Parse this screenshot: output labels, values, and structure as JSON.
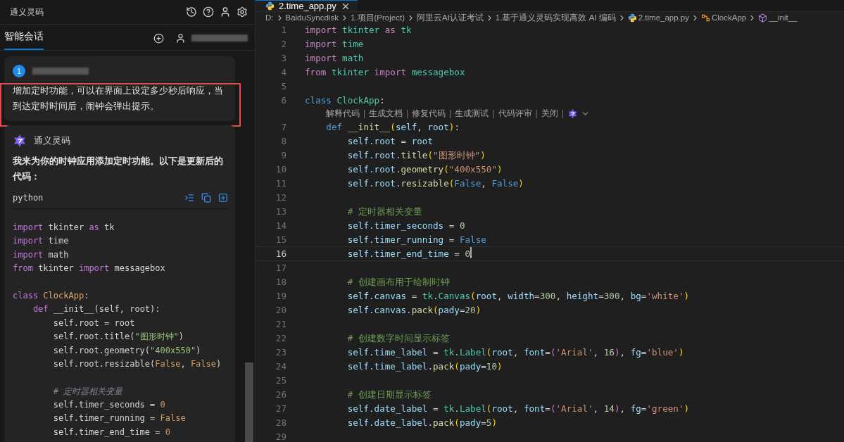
{
  "sidebar": {
    "title": "通义灵码",
    "tab": {
      "label": "智能会话",
      "selected": true
    },
    "user_message": {
      "index": "1",
      "text": "增加定时功能，可以在界面上设定多少秒后响应，当到达定时时间后，闹钟会弹出提示。",
      "highlighted": true
    },
    "reply": {
      "author": "通义灵码",
      "text": "我来为你的时钟应用添加定时功能。以下是更新后的代码：",
      "code_block": {
        "language": "python",
        "lines": [
          {
            "kind": "code",
            "tokens": [
              {
                "text": "import",
                "kind": "kw"
              },
              {
                "text": " tkinter ",
                "kind": "plain"
              },
              {
                "text": "as",
                "kind": "kw"
              },
              {
                "text": " tk",
                "kind": "plain"
              }
            ]
          },
          {
            "kind": "code",
            "tokens": [
              {
                "text": "import",
                "kind": "kw"
              },
              {
                "text": " time",
                "kind": "plain"
              }
            ]
          },
          {
            "kind": "code",
            "tokens": [
              {
                "text": "import",
                "kind": "kw"
              },
              {
                "text": " math",
                "kind": "plain"
              }
            ]
          },
          {
            "kind": "code",
            "tokens": [
              {
                "text": "from",
                "kind": "kw"
              },
              {
                "text": " tkinter ",
                "kind": "plain"
              },
              {
                "text": "import",
                "kind": "kw"
              },
              {
                "text": " messagebox",
                "kind": "plain"
              }
            ]
          },
          {
            "kind": "blank"
          },
          {
            "kind": "code",
            "tokens": [
              {
                "text": "class",
                "kind": "kw"
              },
              {
                "text": " ClockApp",
                "kind": "cls"
              },
              {
                "text": ":",
                "kind": "plain"
              }
            ]
          },
          {
            "kind": "code",
            "tokens": [
              {
                "text": "    def",
                "kind": "def"
              },
              {
                "text": " __init__",
                "kind": "fn"
              },
              {
                "text": "(self, root):",
                "kind": "plain"
              }
            ]
          },
          {
            "kind": "code",
            "tokens": [
              {
                "text": "        self.root = root",
                "kind": "plain"
              }
            ]
          },
          {
            "kind": "code",
            "tokens": [
              {
                "text": "        self.root.title(",
                "kind": "plain"
              },
              {
                "text": "\"图形时钟\"",
                "kind": "str"
              },
              {
                "text": ")",
                "kind": "plain"
              }
            ]
          },
          {
            "kind": "code",
            "tokens": [
              {
                "text": "        self.root.geometry(",
                "kind": "plain"
              },
              {
                "text": "\"400x550\"",
                "kind": "str"
              },
              {
                "text": ")",
                "kind": "plain"
              }
            ]
          },
          {
            "kind": "code",
            "tokens": [
              {
                "text": "        self.root.resizable(",
                "kind": "plain"
              },
              {
                "text": "False",
                "kind": "const"
              },
              {
                "text": ", ",
                "kind": "plain"
              },
              {
                "text": "False",
                "kind": "const"
              },
              {
                "text": ")",
                "kind": "plain"
              }
            ]
          },
          {
            "kind": "blank"
          },
          {
            "kind": "code",
            "tokens": [
              {
                "text": "        # 定时器相关变量",
                "kind": "com"
              }
            ]
          },
          {
            "kind": "code",
            "tokens": [
              {
                "text": "        self.timer_seconds = ",
                "kind": "plain"
              },
              {
                "text": "0",
                "kind": "num"
              }
            ]
          },
          {
            "kind": "code",
            "tokens": [
              {
                "text": "        self.timer_running = ",
                "kind": "plain"
              },
              {
                "text": "False",
                "kind": "const"
              }
            ]
          },
          {
            "kind": "code",
            "tokens": [
              {
                "text": "        self.timer_end_time = ",
                "kind": "plain"
              },
              {
                "text": "0",
                "kind": "num"
              }
            ]
          }
        ]
      }
    }
  },
  "editor": {
    "tab": {
      "label": "2.time_app.py",
      "selected": true
    },
    "breadcrumbs": [
      {
        "label": "D:",
        "kind": "text"
      },
      {
        "label": "BaiduSyncdisk",
        "kind": "text"
      },
      {
        "label": "1.项目(Project)",
        "kind": "text"
      },
      {
        "label": "阿里云AI认证考试",
        "kind": "text"
      },
      {
        "label": "1.基于通义灵码实现高效 AI 编码",
        "kind": "text"
      },
      {
        "label": "2.time_app.py",
        "kind": "file"
      },
      {
        "label": "ClockApp",
        "kind": "class"
      },
      {
        "label": "__init__",
        "kind": "method"
      }
    ],
    "lines": [
      {
        "kind": "code",
        "number": "1",
        "current": false,
        "tokens": [
          {
            "text": "import",
            "kind": "kw"
          },
          {
            "text": " tkinter ",
            "kind": "mod"
          },
          {
            "text": "as",
            "kind": "kw"
          },
          {
            "text": " tk",
            "kind": "mod"
          }
        ]
      },
      {
        "kind": "code",
        "number": "2",
        "current": false,
        "tokens": [
          {
            "text": "import",
            "kind": "kw"
          },
          {
            "text": " time",
            "kind": "mod"
          }
        ]
      },
      {
        "kind": "code",
        "number": "3",
        "current": false,
        "tokens": [
          {
            "text": "import",
            "kind": "kw"
          },
          {
            "text": " math",
            "kind": "mod"
          }
        ]
      },
      {
        "kind": "code",
        "number": "4",
        "current": false,
        "tokens": [
          {
            "text": "from",
            "kind": "kw"
          },
          {
            "text": " tkinter ",
            "kind": "mod"
          },
          {
            "text": "import",
            "kind": "kw"
          },
          {
            "text": " messagebox",
            "kind": "mod"
          }
        ]
      },
      {
        "kind": "code",
        "number": "5",
        "current": false
      },
      {
        "kind": "code",
        "number": "6",
        "current": false,
        "tokens": [
          {
            "text": "class",
            "kind": "def"
          },
          {
            "text": " ClockApp",
            "kind": "cls"
          },
          {
            "text": ":",
            "kind": "punc"
          }
        ]
      },
      {
        "kind": "codelens",
        "items": [
          {
            "label": "解释代码",
            "kind": "action"
          },
          {
            "label": "|",
            "kind": "separator"
          },
          {
            "label": "生成文档",
            "kind": "action"
          },
          {
            "label": "|",
            "kind": "separator"
          },
          {
            "label": "修复代码",
            "kind": "action"
          },
          {
            "label": "|",
            "kind": "separator"
          },
          {
            "label": "生成测试",
            "kind": "action"
          },
          {
            "label": "|",
            "kind": "separator"
          },
          {
            "label": "代码评审",
            "kind": "action"
          },
          {
            "label": "|",
            "kind": "separator"
          },
          {
            "label": "关闭",
            "kind": "action"
          },
          {
            "label": "|",
            "kind": "separator"
          }
        ]
      },
      {
        "kind": "code",
        "number": "7",
        "current": false,
        "tokens": [
          {
            "text": "    def",
            "kind": "def"
          },
          {
            "text": " __init__",
            "kind": "fn"
          },
          {
            "text": "(",
            "kind": "paren"
          },
          {
            "text": "self",
            "kind": "var"
          },
          {
            "text": ", ",
            "kind": "punc"
          },
          {
            "text": "root",
            "kind": "var"
          },
          {
            "text": ")",
            "kind": "paren"
          },
          {
            "text": ":",
            "kind": "punc"
          }
        ]
      },
      {
        "kind": "code",
        "number": "8",
        "current": false,
        "tokens": [
          {
            "text": "        self.root",
            "kind": "var"
          },
          {
            "text": " = ",
            "kind": "punc"
          },
          {
            "text": "root",
            "kind": "var"
          }
        ]
      },
      {
        "kind": "code",
        "number": "9",
        "current": false,
        "tokens": [
          {
            "text": "        self.root.",
            "kind": "var"
          },
          {
            "text": "title",
            "kind": "fn"
          },
          {
            "text": "(",
            "kind": "paren"
          },
          {
            "text": "\"图形时钟\"",
            "kind": "str"
          },
          {
            "text": ")",
            "kind": "paren"
          }
        ]
      },
      {
        "kind": "code",
        "number": "10",
        "current": false,
        "tokens": [
          {
            "text": "        self.root.",
            "kind": "var"
          },
          {
            "text": "geometry",
            "kind": "fn"
          },
          {
            "text": "(",
            "kind": "paren"
          },
          {
            "text": "\"400x550\"",
            "kind": "str"
          },
          {
            "text": ")",
            "kind": "paren"
          }
        ]
      },
      {
        "kind": "code",
        "number": "11",
        "current": false,
        "tokens": [
          {
            "text": "        self.root.",
            "kind": "var"
          },
          {
            "text": "resizable",
            "kind": "fn"
          },
          {
            "text": "(",
            "kind": "paren"
          },
          {
            "text": "False",
            "kind": "const"
          },
          {
            "text": ", ",
            "kind": "punc"
          },
          {
            "text": "False",
            "kind": "const"
          },
          {
            "text": ")",
            "kind": "paren"
          }
        ]
      },
      {
        "kind": "code",
        "number": "12",
        "current": false
      },
      {
        "kind": "code",
        "number": "13",
        "current": false,
        "tokens": [
          {
            "text": "        # 定时器相关变量",
            "kind": "com"
          }
        ]
      },
      {
        "kind": "code",
        "number": "14",
        "current": false,
        "tokens": [
          {
            "text": "        self.timer_seconds",
            "kind": "var"
          },
          {
            "text": " = ",
            "kind": "punc"
          },
          {
            "text": "0",
            "kind": "num"
          }
        ]
      },
      {
        "kind": "code",
        "number": "15",
        "current": false,
        "tokens": [
          {
            "text": "        self.timer_running",
            "kind": "var"
          },
          {
            "text": " = ",
            "kind": "punc"
          },
          {
            "text": "False",
            "kind": "const"
          }
        ]
      },
      {
        "kind": "code",
        "number": "16",
        "current": true,
        "tokens": [
          {
            "text": "        self.timer_end_time",
            "kind": "var"
          },
          {
            "text": " = ",
            "kind": "punc"
          },
          {
            "text": "0",
            "kind": "num"
          }
        ]
      },
      {
        "kind": "code",
        "number": "17",
        "current": false
      },
      {
        "kind": "code",
        "number": "18",
        "current": false,
        "tokens": [
          {
            "text": "        # 创建画布用于绘制时钟",
            "kind": "com"
          }
        ]
      },
      {
        "kind": "code",
        "number": "19",
        "current": false,
        "tokens": [
          {
            "text": "        self.canvas",
            "kind": "var"
          },
          {
            "text": " = ",
            "kind": "punc"
          },
          {
            "text": "tk",
            "kind": "mod"
          },
          {
            "text": ".",
            "kind": "punc"
          },
          {
            "text": "Canvas",
            "kind": "cls"
          },
          {
            "text": "(",
            "kind": "paren"
          },
          {
            "text": "root",
            "kind": "var"
          },
          {
            "text": ", ",
            "kind": "punc"
          },
          {
            "text": "width",
            "kind": "var"
          },
          {
            "text": "=",
            "kind": "punc"
          },
          {
            "text": "300",
            "kind": "num"
          },
          {
            "text": ", ",
            "kind": "punc"
          },
          {
            "text": "height",
            "kind": "var"
          },
          {
            "text": "=",
            "kind": "punc"
          },
          {
            "text": "300",
            "kind": "num"
          },
          {
            "text": ", ",
            "kind": "punc"
          },
          {
            "text": "bg",
            "kind": "var"
          },
          {
            "text": "=",
            "kind": "punc"
          },
          {
            "text": "'white'",
            "kind": "str"
          },
          {
            "text": ")",
            "kind": "paren"
          }
        ]
      },
      {
        "kind": "code",
        "number": "20",
        "current": false,
        "tokens": [
          {
            "text": "        self.canvas.",
            "kind": "var"
          },
          {
            "text": "pack",
            "kind": "fn"
          },
          {
            "text": "(",
            "kind": "paren"
          },
          {
            "text": "pady",
            "kind": "var"
          },
          {
            "text": "=",
            "kind": "punc"
          },
          {
            "text": "20",
            "kind": "num"
          },
          {
            "text": ")",
            "kind": "paren"
          }
        ]
      },
      {
        "kind": "code",
        "number": "21",
        "current": false
      },
      {
        "kind": "code",
        "number": "22",
        "current": false,
        "tokens": [
          {
            "text": "        # 创建数字时间显示标签",
            "kind": "com"
          }
        ]
      },
      {
        "kind": "code",
        "number": "23",
        "current": false,
        "tokens": [
          {
            "text": "        self.time_label",
            "kind": "var"
          },
          {
            "text": " = ",
            "kind": "punc"
          },
          {
            "text": "tk",
            "kind": "mod"
          },
          {
            "text": ".",
            "kind": "punc"
          },
          {
            "text": "Label",
            "kind": "cls"
          },
          {
            "text": "(",
            "kind": "paren"
          },
          {
            "text": "root",
            "kind": "var"
          },
          {
            "text": ", ",
            "kind": "punc"
          },
          {
            "text": "font",
            "kind": "var"
          },
          {
            "text": "=",
            "kind": "punc"
          },
          {
            "text": "(",
            "kind": "paren2"
          },
          {
            "text": "'Arial'",
            "kind": "str"
          },
          {
            "text": ", ",
            "kind": "punc"
          },
          {
            "text": "16",
            "kind": "num"
          },
          {
            "text": ")",
            "kind": "paren2"
          },
          {
            "text": ", ",
            "kind": "punc"
          },
          {
            "text": "fg",
            "kind": "var"
          },
          {
            "text": "=",
            "kind": "punc"
          },
          {
            "text": "'blue'",
            "kind": "str"
          },
          {
            "text": ")",
            "kind": "paren"
          }
        ]
      },
      {
        "kind": "code",
        "number": "24",
        "current": false,
        "tokens": [
          {
            "text": "        self.time_label.",
            "kind": "var"
          },
          {
            "text": "pack",
            "kind": "fn"
          },
          {
            "text": "(",
            "kind": "paren"
          },
          {
            "text": "pady",
            "kind": "var"
          },
          {
            "text": "=",
            "kind": "punc"
          },
          {
            "text": "10",
            "kind": "num"
          },
          {
            "text": ")",
            "kind": "paren"
          }
        ]
      },
      {
        "kind": "code",
        "number": "25",
        "current": false
      },
      {
        "kind": "code",
        "number": "26",
        "current": false,
        "tokens": [
          {
            "text": "        # 创建日期显示标签",
            "kind": "com"
          }
        ]
      },
      {
        "kind": "code",
        "number": "27",
        "current": false,
        "tokens": [
          {
            "text": "        self.date_label",
            "kind": "var"
          },
          {
            "text": " = ",
            "kind": "punc"
          },
          {
            "text": "tk",
            "kind": "mod"
          },
          {
            "text": ".",
            "kind": "punc"
          },
          {
            "text": "Label",
            "kind": "cls"
          },
          {
            "text": "(",
            "kind": "paren"
          },
          {
            "text": "root",
            "kind": "var"
          },
          {
            "text": ", ",
            "kind": "punc"
          },
          {
            "text": "font",
            "kind": "var"
          },
          {
            "text": "=",
            "kind": "punc"
          },
          {
            "text": "(",
            "kind": "paren2"
          },
          {
            "text": "'Arial'",
            "kind": "str"
          },
          {
            "text": ", ",
            "kind": "punc"
          },
          {
            "text": "14",
            "kind": "num"
          },
          {
            "text": ")",
            "kind": "paren2"
          },
          {
            "text": ", ",
            "kind": "punc"
          },
          {
            "text": "fg",
            "kind": "var"
          },
          {
            "text": "=",
            "kind": "punc"
          },
          {
            "text": "'green'",
            "kind": "str"
          },
          {
            "text": ")",
            "kind": "paren"
          }
        ]
      },
      {
        "kind": "code",
        "number": "28",
        "current": false,
        "tokens": [
          {
            "text": "        self.date_label.",
            "kind": "var"
          },
          {
            "text": "pack",
            "kind": "fn"
          },
          {
            "text": "(",
            "kind": "paren"
          },
          {
            "text": "pady",
            "kind": "var"
          },
          {
            "text": "=",
            "kind": "punc"
          },
          {
            "text": "5",
            "kind": "num"
          },
          {
            "text": ")",
            "kind": "paren"
          }
        ]
      },
      {
        "kind": "code",
        "number": "29",
        "current": false
      }
    ]
  }
}
